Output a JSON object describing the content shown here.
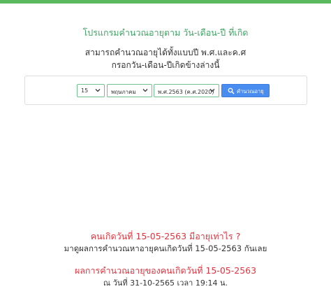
{
  "colors": {
    "accent_green": "#5cb85c",
    "title_green": "#3fa564",
    "result_red": "#e0353f",
    "button_blue": "#4a8df0"
  },
  "header": {
    "title": "โปรแกรมคำนวณอายุตาม วัน-เดือน-ปี ที่เกิด",
    "subtitle_line1": "สามารถคำนวณอายุได้ทั้งแบบปี พ.ศ.และค.ศ",
    "subtitle_line2": "กรอกวัน-เดือน-ปีเกิดข้างล่างนี้"
  },
  "form": {
    "day_value": "15",
    "month_value": "พฤษภาคม",
    "year_value": "พ.ศ.2563 (ค.ศ.2020)",
    "calc_button_label": "คำนวณอายุ",
    "chevron_icon": "chevron-down-icon",
    "search_icon": "search-icon"
  },
  "result": {
    "question": "คนเกิดวันที่ 15-05-2563 มีอายุเท่าไร ?",
    "intro": "มาดูผลการคำนวณหาอายุคนเกิดวันที่ 15-05-2563 กันเลย",
    "heading": "ผลการคำนวณอายุของคนเกิดวันที่ 15-05-2563",
    "as_of": "ณ วันที่ 31-10-2565 เวลา 19:14 น."
  }
}
